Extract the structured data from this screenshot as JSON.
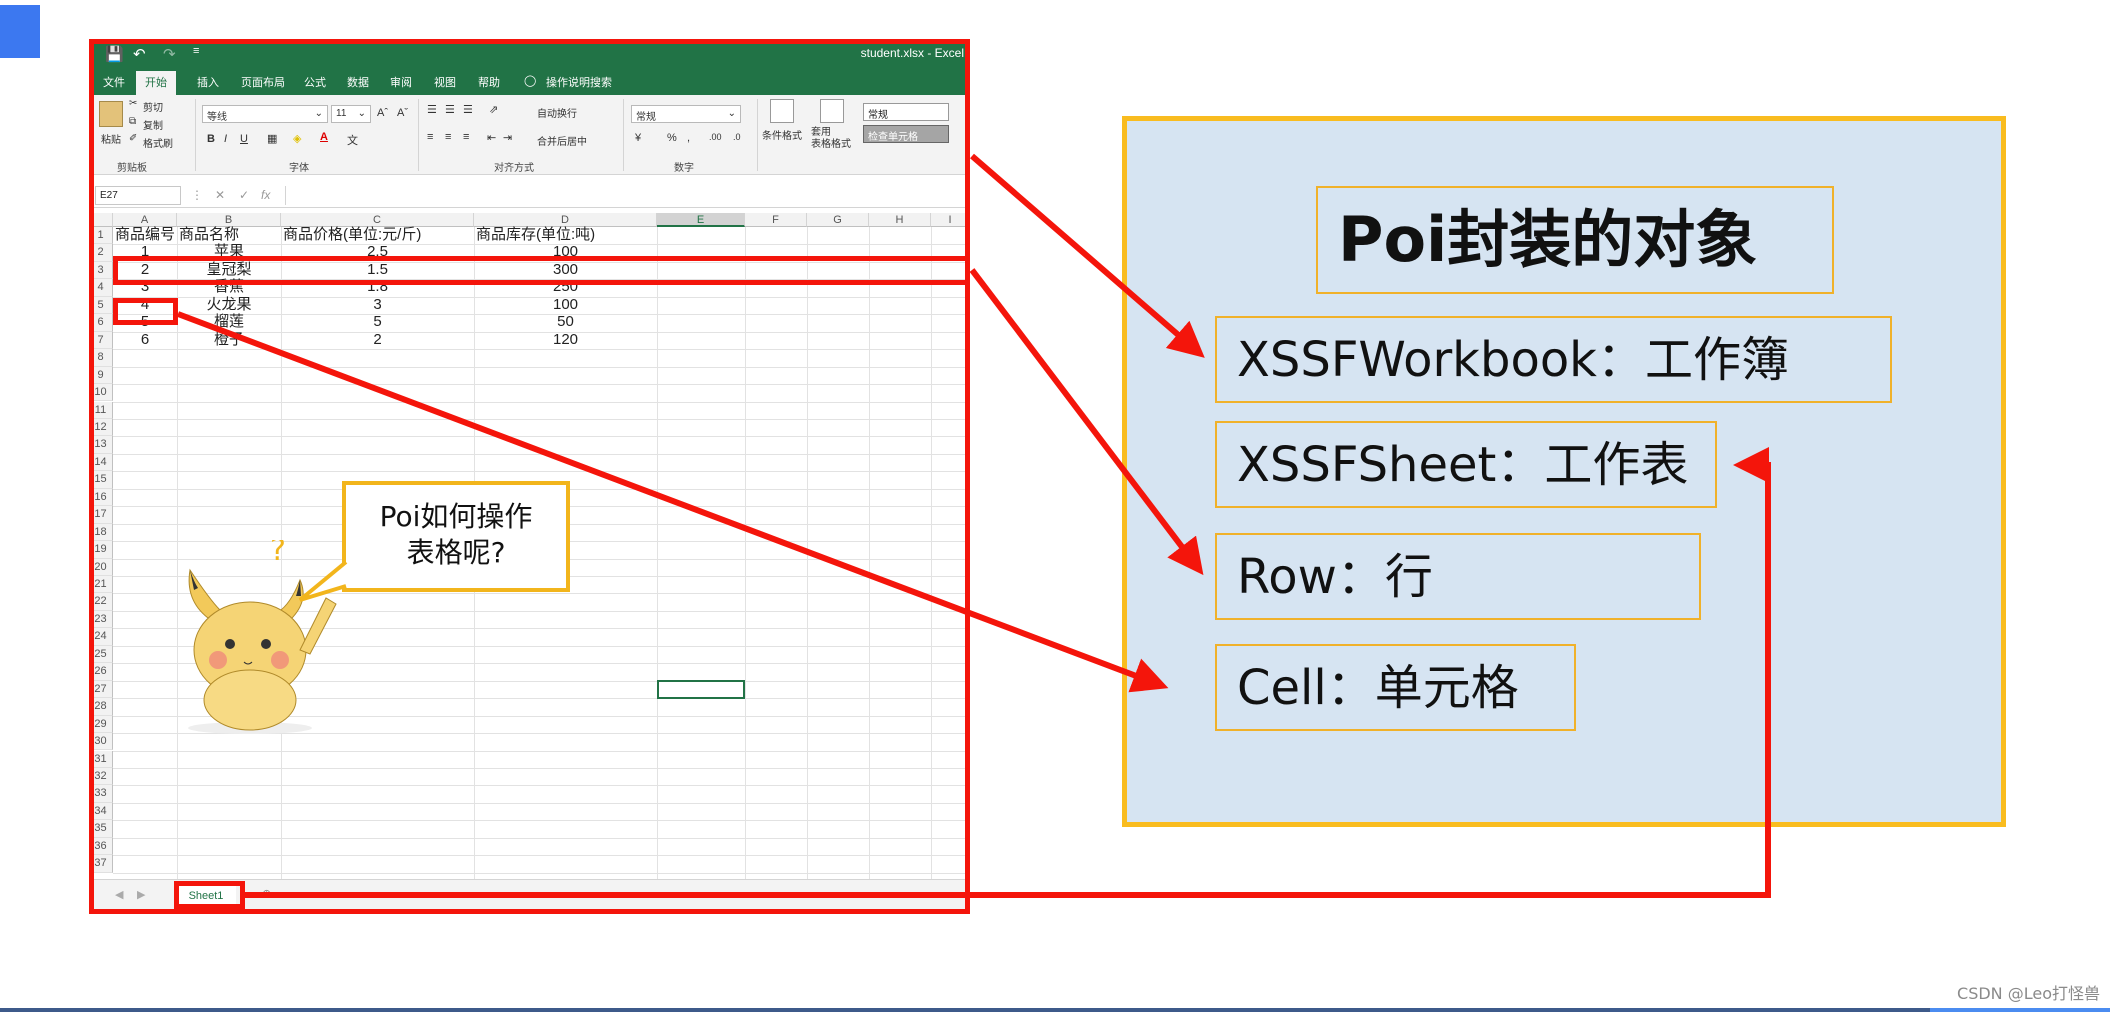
{
  "excel": {
    "window_title": "student.xlsx  -  Excel",
    "menu_tabs": [
      "文件",
      "开始",
      "插入",
      "页面布局",
      "公式",
      "数据",
      "审阅",
      "视图",
      "帮助",
      "操作说明搜索"
    ],
    "ribbon": {
      "paste": "粘贴",
      "cut": "剪切",
      "copy": "复制",
      "format_painter": "格式刷",
      "clipboard_group": "剪贴板",
      "font_name": "等线",
      "font_size": "11",
      "font_group": "字体",
      "wrap_text": "自动换行",
      "merge_center": "合并后居中",
      "align_group": "对齐方式",
      "number_format": "常规",
      "number_group": "数字",
      "cond_format": "条件格式",
      "table_format": "套用\n表格格式",
      "style_normal": "常规",
      "style_check": "检查单元格",
      "bold": "B",
      "italic": "I",
      "underline": "U",
      "percent": "%"
    },
    "name_box": "E27",
    "fx": "fx",
    "columns": [
      "A",
      "B",
      "C",
      "D",
      "E",
      "F",
      "G",
      "H",
      "I"
    ],
    "header_row": [
      "商品编号",
      "商品名称",
      "商品价格(单位:元/斤)",
      "商品库存(单位:吨)"
    ],
    "rows": [
      [
        "1",
        "苹果",
        "2.5",
        "100"
      ],
      [
        "2",
        "皇冠梨",
        "1.5",
        "300"
      ],
      [
        "3",
        "香蕉",
        "1.8",
        "250"
      ],
      [
        "4",
        "火龙果",
        "3",
        "100"
      ],
      [
        "5",
        "榴莲",
        "5",
        "50"
      ],
      [
        "6",
        "橙子",
        "2",
        "120"
      ]
    ],
    "row_count": 37,
    "sheet_tab": "Sheet1"
  },
  "bubble": {
    "line1": "Poi如何操作",
    "line2": "表格呢?"
  },
  "panel": {
    "title": "Poi封装的对象",
    "items": [
      {
        "text": "XSSFWorkbook：工作簿"
      },
      {
        "text": "XSSFSheet：工作表"
      },
      {
        "text": "Row：行"
      },
      {
        "text": "Cell：单元格"
      }
    ]
  },
  "colors": {
    "excel_green": "#217346",
    "highlight_red": "#f4150b",
    "panel_bg": "#d6e4f2",
    "panel_border": "#f9bc1f"
  },
  "watermark": "CSDN @Leo打怪兽"
}
